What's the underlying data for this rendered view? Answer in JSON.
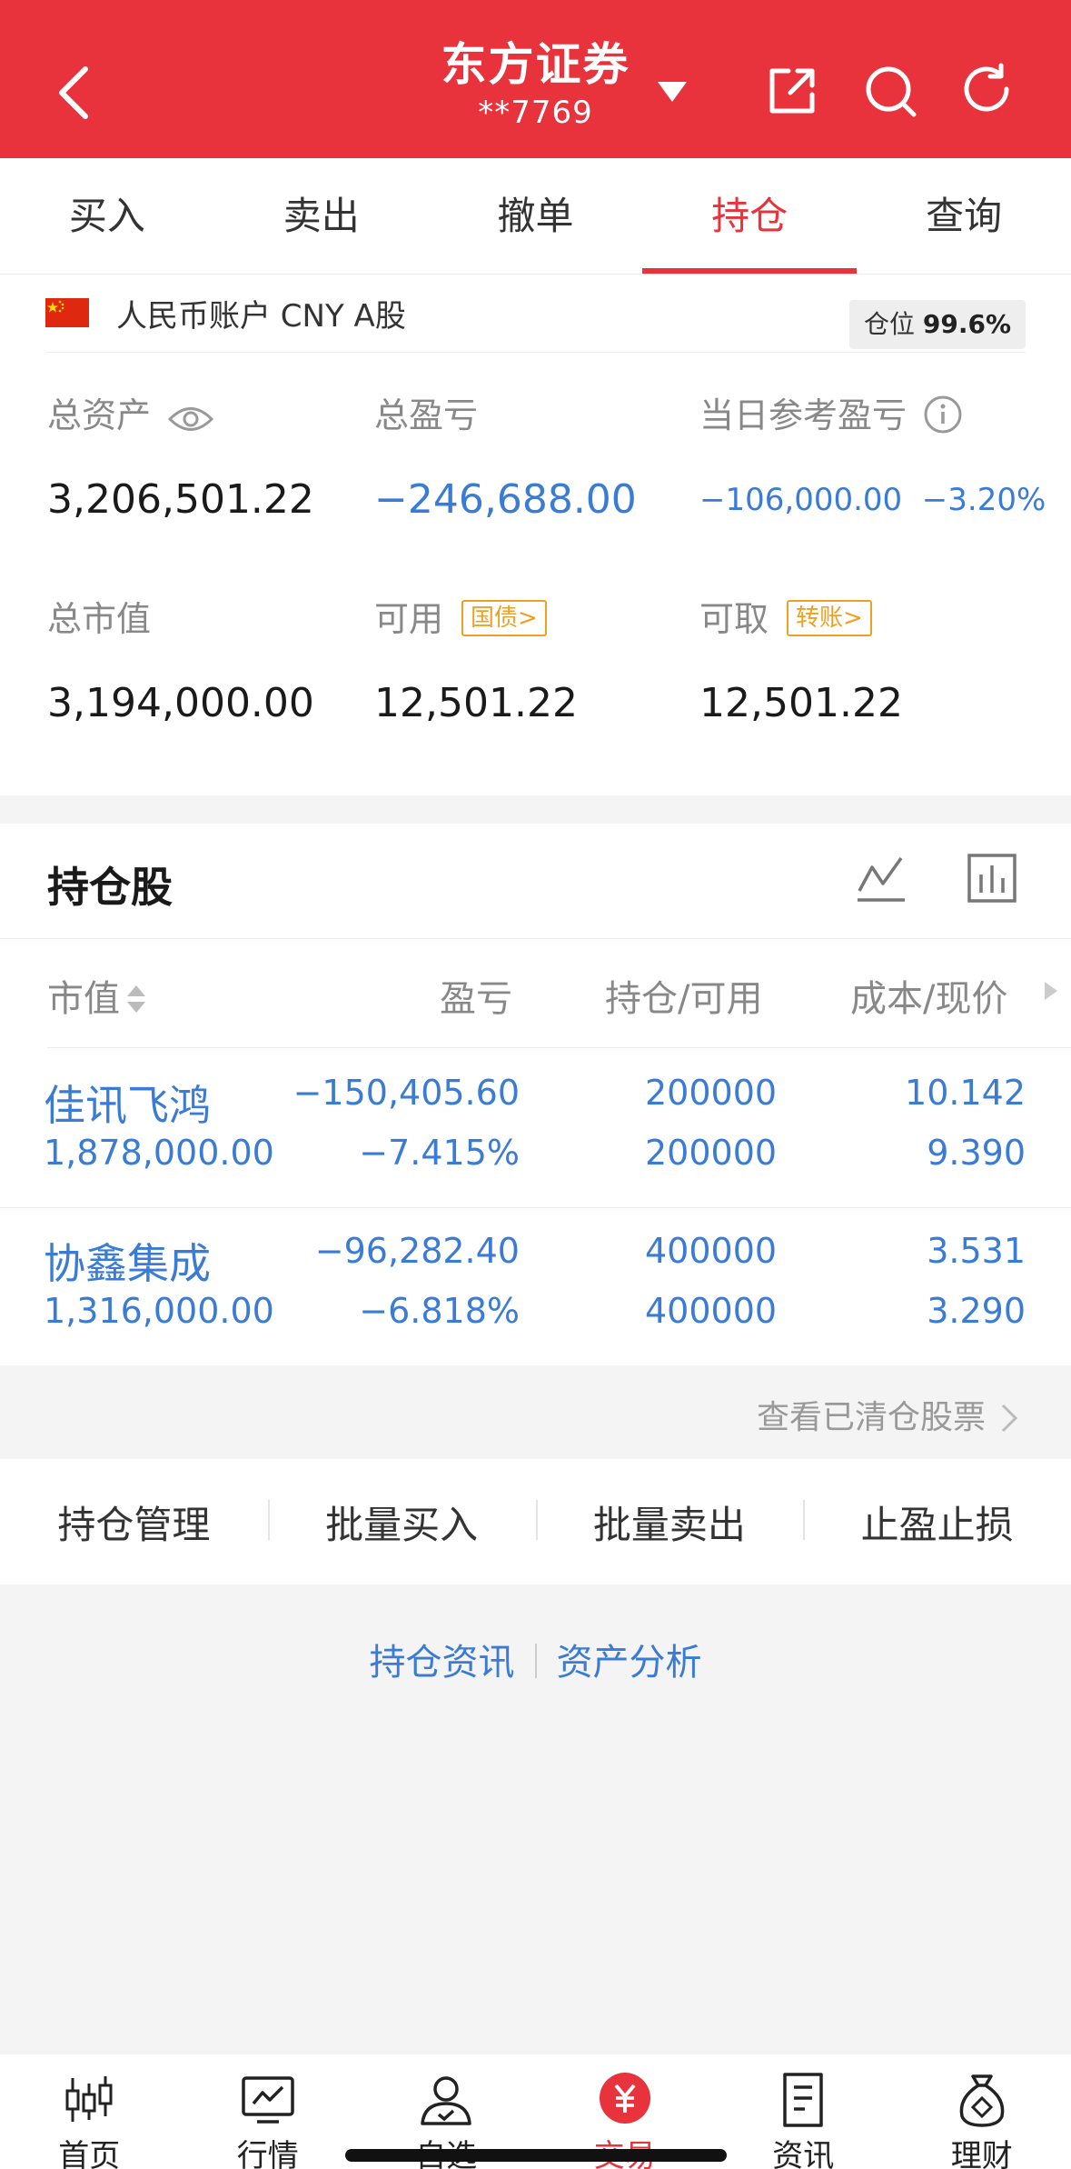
{
  "header": {
    "title": "东方证券",
    "account_masked": "**7769",
    "back_icon": "chevron-left-icon",
    "icons": [
      "share-icon",
      "search-icon",
      "refresh-icon"
    ],
    "bg_color": "#e8323c"
  },
  "tabs": [
    {
      "label": "买入",
      "active": false
    },
    {
      "label": "卖出",
      "active": false
    },
    {
      "label": "撤单",
      "active": false
    },
    {
      "label": "持仓",
      "active": true
    },
    {
      "label": "查询",
      "active": false
    }
  ],
  "account": {
    "label": "人民币账户 CNY A股",
    "position_label": "仓位",
    "position_value": "99.6%"
  },
  "summary": {
    "total_assets_label": "总资产",
    "total_assets": "3,206,501.22",
    "total_pnl_label": "总盈亏",
    "total_pnl": "−246,688.00",
    "daily_pnl_label": "当日参考盈亏",
    "daily_pnl": "−106,000.00",
    "daily_pnl_pct": "−3.20%",
    "market_value_label": "总市值",
    "market_value": "3,194,000.00",
    "available_label": "可用",
    "available_tag": "国债>",
    "available": "12,501.22",
    "withdrawable_label": "可取",
    "withdrawable_tag": "转账>",
    "withdrawable": "12,501.22"
  },
  "holdings": {
    "title": "持仓股",
    "columns": [
      "市值",
      "盈亏",
      "持仓/可用",
      "成本/现价"
    ],
    "rows": [
      {
        "name": "佳讯飞鸿",
        "market_value": "1,878,000.00",
        "pnl": "−150,405.60",
        "pnl_pct": "−7.415%",
        "position": "200000",
        "available": "200000",
        "cost": "10.142",
        "price": "9.390"
      },
      {
        "name": "协鑫集成",
        "market_value": "1,316,000.00",
        "pnl": "−96,282.40",
        "pnl_pct": "−6.818%",
        "position": "400000",
        "available": "400000",
        "cost": "3.531",
        "price": "3.290"
      }
    ],
    "cleared_link": "查看已清仓股票"
  },
  "actions": [
    "持仓管理",
    "批量买入",
    "批量卖出",
    "止盈止损"
  ],
  "links": [
    "持仓资讯",
    "资产分析"
  ],
  "bottom_nav": [
    {
      "label": "首页",
      "icon": "candlestick-icon",
      "active": false
    },
    {
      "label": "行情",
      "icon": "trend-chart-icon",
      "active": false
    },
    {
      "label": "自选",
      "icon": "user-check-icon",
      "active": false
    },
    {
      "label": "交易",
      "icon": "yuan-icon",
      "active": true
    },
    {
      "label": "资讯",
      "icon": "document-icon",
      "active": false
    },
    {
      "label": "理财",
      "icon": "money-bag-icon",
      "active": false
    }
  ]
}
